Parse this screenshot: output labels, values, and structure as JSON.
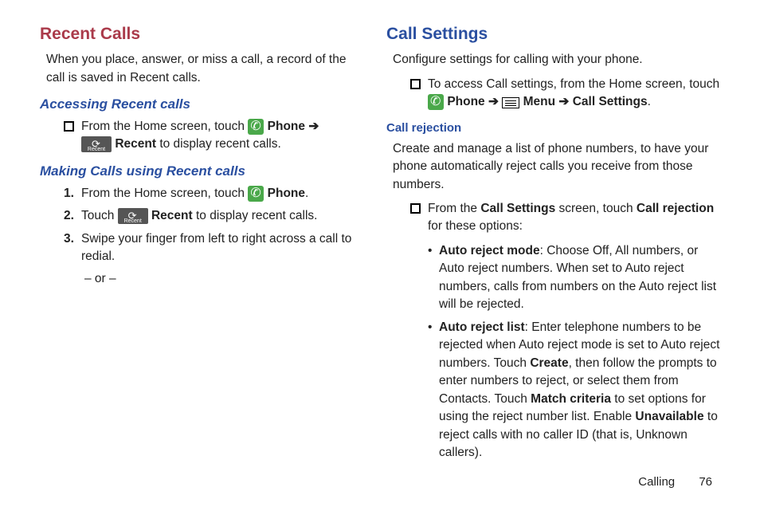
{
  "left": {
    "h_recent_calls": "Recent Calls",
    "p_intro": "When you place, answer, or miss a call, a record of the call is saved in Recent calls.",
    "h_accessing": "Accessing Recent calls",
    "li_access_pre": "From the Home screen, touch ",
    "li_access_phone": "Phone",
    "li_access_recent": "Recent",
    "li_access_post": " to display recent calls.",
    "h_making": "Making Calls using Recent calls",
    "ol1_pre": "From the Home screen, touch ",
    "ol1_phone": "Phone",
    "ol2_pre": "Touch ",
    "ol2_recent": "Recent",
    "ol2_post": " to display recent calls.",
    "ol3": "Swipe your finger from left to right across a call to redial.",
    "or": "– or –",
    "n1": "1.",
    "n2": "2.",
    "n3": "3.",
    "arrow": "➔"
  },
  "right": {
    "h_call_settings": "Call Settings",
    "p_intro": "Configure settings for calling with your phone.",
    "li_access_pre": "To access Call settings, from the Home screen, touch ",
    "phone": "Phone",
    "menu": "Menu",
    "call_settings": "Call Settings",
    "arrow": "➔",
    "period": ".",
    "h_call_rejection": "Call rejection",
    "p_rejection": "Create and manage a list of phone numbers, to have your phone automatically reject calls you receive from those numbers.",
    "li_rej_pre": "From the ",
    "li_rej_cs": "Call Settings",
    "li_rej_mid": " screen, touch ",
    "li_rej_cr": "Call rejection",
    "li_rej_post": " for these options:",
    "b1_label": "Auto reject mode",
    "b1_text": ": Choose Off, All numbers, or Auto reject numbers. When set to Auto reject numbers, calls from numbers on the Auto reject list will be rejected.",
    "b2_label": "Auto reject list",
    "b2_text_a": ": Enter telephone numbers to be rejected when Auto reject mode is set to Auto reject numbers. Touch ",
    "b2_create": "Create",
    "b2_text_b": ", then follow the prompts to enter numbers to reject, or select them from Contacts. Touch ",
    "b2_match": "Match criteria",
    "b2_text_c": " to set options for using the reject number list. Enable ",
    "b2_unavailable": "Unavailable",
    "b2_text_d": " to reject calls with no caller ID (that is, Unknown callers)."
  },
  "footer": {
    "section": "Calling",
    "page": "76"
  }
}
